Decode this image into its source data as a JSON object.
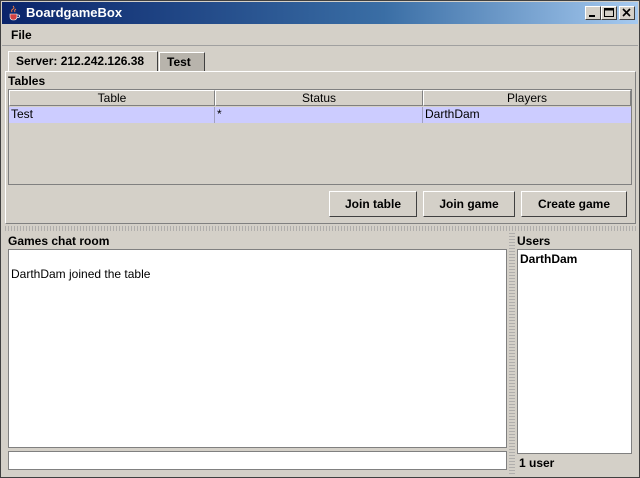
{
  "window": {
    "title": "BoardgameBox",
    "icon": "java-cup-icon"
  },
  "menu": {
    "file": "File"
  },
  "tabs": [
    {
      "label": "Server: 212.242.126.38",
      "active": true
    },
    {
      "label": "Test",
      "active": false
    }
  ],
  "tables": {
    "label": "Tables",
    "columns": [
      "Table",
      "Status",
      "Players"
    ],
    "rows": [
      {
        "table": "Test",
        "status": "*",
        "players": "DarthDam",
        "selected": true
      }
    ]
  },
  "actions": {
    "join_table": "Join table",
    "join_game": "Join game",
    "create_game": "Create game"
  },
  "chat": {
    "label": "Games chat room",
    "messages": [
      "DarthDam joined the table"
    ],
    "input_value": ""
  },
  "users": {
    "label": "Users",
    "items": [
      "DarthDam"
    ],
    "count": "1 user"
  },
  "colors": {
    "selection": "#ccccff",
    "titlebar_start": "#0a246a",
    "face": "#d4d0c8"
  }
}
